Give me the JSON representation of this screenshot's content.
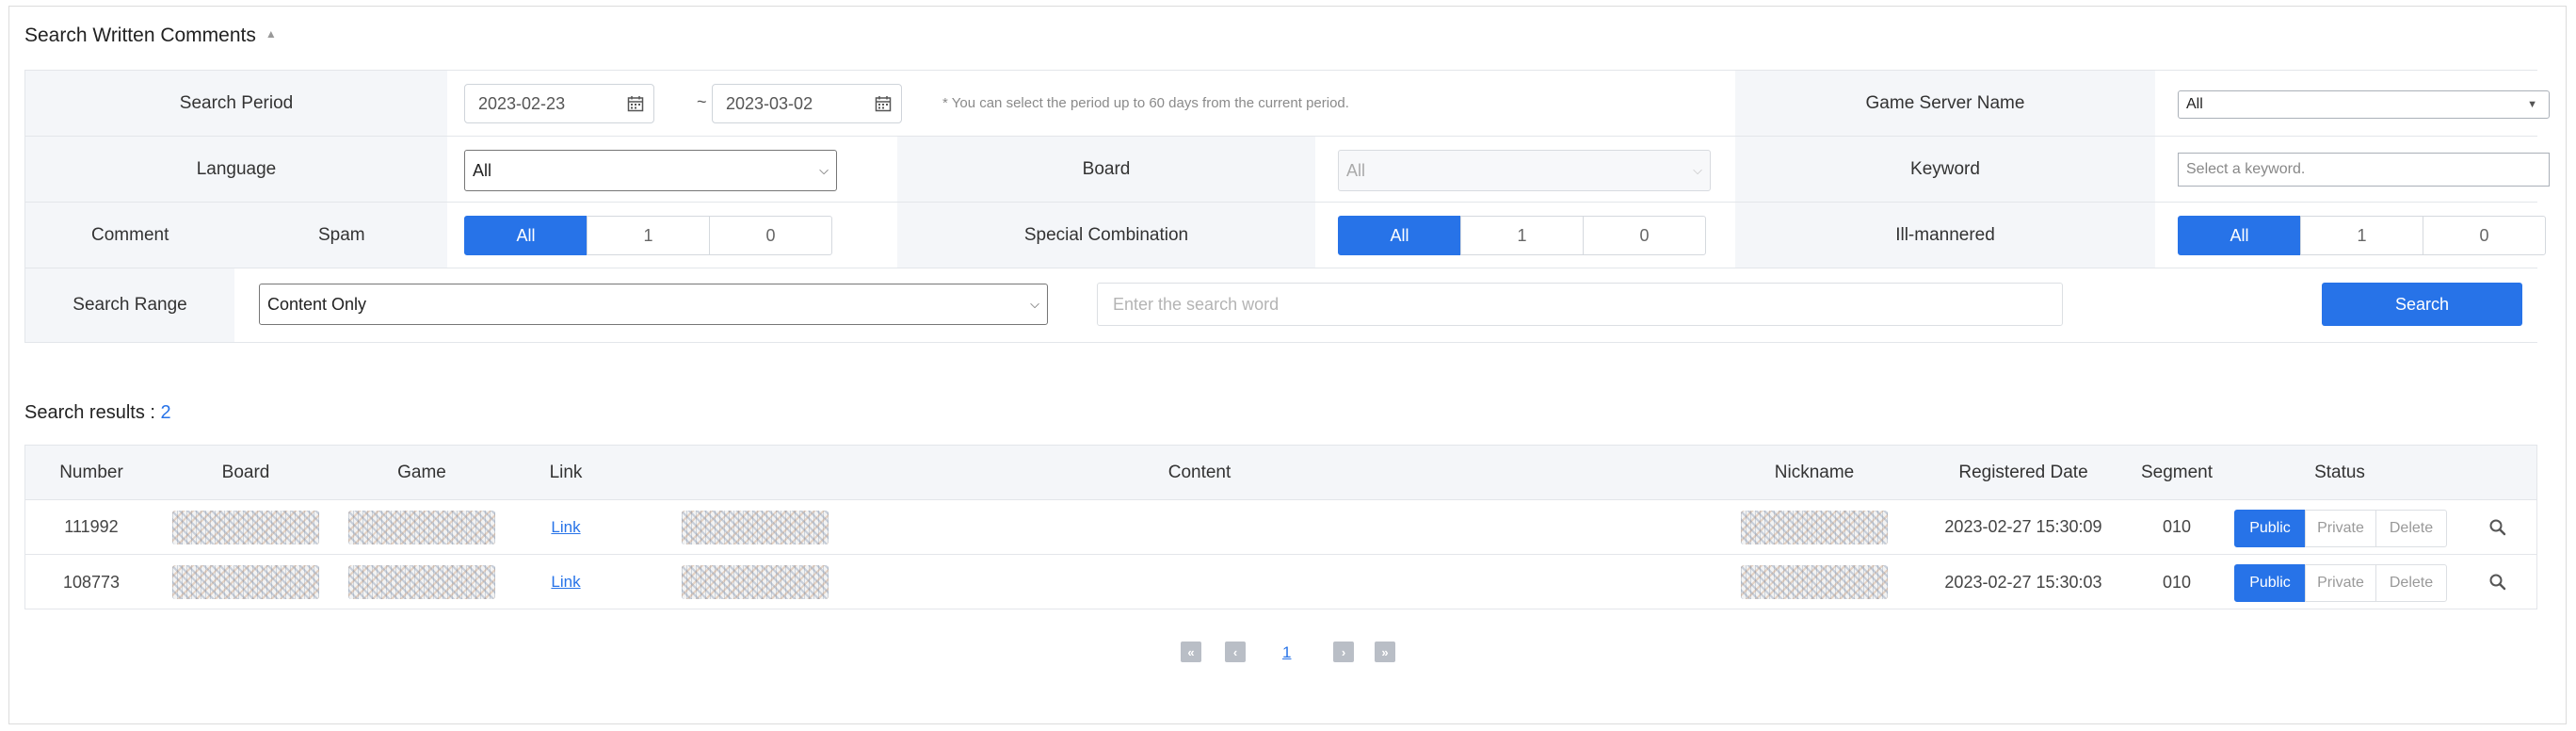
{
  "title": "Search Written Comments",
  "filters": {
    "search_period_label": "Search Period",
    "date_from": "2023-02-23",
    "date_to": "2023-03-02",
    "date_sep": "~",
    "period_note": "* You can select the period up to 60 days from the current period.",
    "game_server_label": "Game Server Name",
    "game_server_value": "All",
    "language_label": "Language",
    "language_value": "All",
    "board_label": "Board",
    "board_value": "All",
    "keyword_label": "Keyword",
    "keyword_placeholder": "Select a keyword.",
    "comment_label": "Comment",
    "spam_label": "Spam",
    "spam_options": [
      "All",
      "1",
      "0"
    ],
    "special_label": "Special Combination",
    "special_options": [
      "All",
      "1",
      "0"
    ],
    "illmannered_label": "Ill-mannered",
    "illmannered_options": [
      "All",
      "1",
      "0"
    ],
    "search_range_label": "Search Range",
    "search_range_value": "Content Only",
    "search_word_placeholder": "Enter the search word",
    "search_button": "Search"
  },
  "results": {
    "label": "Search results : ",
    "count": "2",
    "columns": [
      "Number",
      "Board",
      "Game",
      "Link",
      "Content",
      "Nickname",
      "Registered Date",
      "Segment",
      "Status"
    ],
    "rows": [
      {
        "number": "111992",
        "link": "Link",
        "date": "2023-02-27 15:30:09",
        "segment": "010",
        "status": [
          "Public",
          "Private",
          "Delete"
        ]
      },
      {
        "number": "108773",
        "link": "Link",
        "date": "2023-02-27 15:30:03",
        "segment": "010",
        "status": [
          "Public",
          "Private",
          "Delete"
        ]
      }
    ]
  },
  "pagination": {
    "current": "1"
  },
  "colors": {
    "accent": "#2773e8",
    "label_bg": "#f4f6f9",
    "border": "#e3e6ea"
  }
}
